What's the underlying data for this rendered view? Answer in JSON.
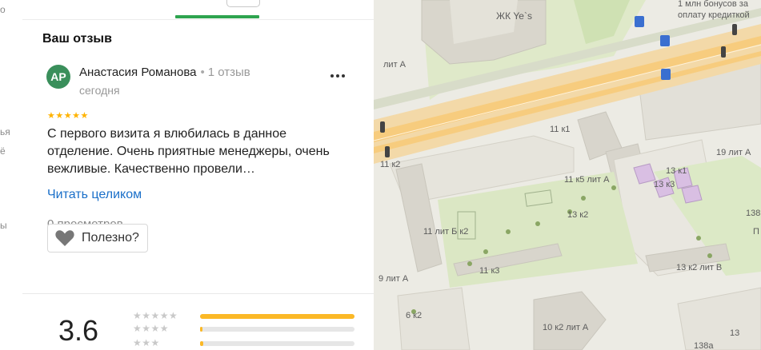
{
  "left_sliver": {
    "lines": [
      "о",
      "ья",
      "ё",
      "ы"
    ]
  },
  "review": {
    "section_title": "Ваш отзыв",
    "avatar_initials": "АР",
    "author_name": "Анастасия Романова",
    "review_count": "1 отзыв",
    "date": "сегодня",
    "stars": "★★★★★",
    "text": "С первого визита я влюбилась в данное отделение. Очень приятные менеджеры, очень вежливые. Качественно провели…",
    "read_more": "Читать целиком",
    "views": "0 просмотров",
    "useful_label": "Полезно?"
  },
  "rating": {
    "value": "3.6",
    "distribution": [
      {
        "stars": "★★★★★",
        "fraction": 1.0
      },
      {
        "stars": "★★★★",
        "fraction": 0.01
      },
      {
        "stars": "★★★",
        "fraction": 0.02
      }
    ]
  },
  "colors": {
    "accent_green": "#2ea44f",
    "link_blue": "#1a6fc9",
    "star_yellow": "#ffb300",
    "bar_fill": "#fbb826",
    "avatar_bg": "#3a8f5b"
  },
  "map": {
    "labels": {
      "zhk": "ЖК Ye`s",
      "promo": "1 млн бонусов за",
      "promo2": "оплату кредиткой",
      "l1": "лит А",
      "l2": "11 к1",
      "l3": "19 лит А",
      "l4": "11 к5 лит А",
      "l5": "13 к1",
      "l6": "11 к2",
      "l7": "13 к2",
      "l8": "13 к3",
      "l9": "11 лит Б к2",
      "l10": "138",
      "l11": "13 к2 лит В",
      "l12": "11 к3",
      "l13": "9 лит А",
      "l14": "6 к2",
      "l15": "10 к2 лит А",
      "l16": "13",
      "l17": "138а",
      "l18": "П"
    }
  }
}
